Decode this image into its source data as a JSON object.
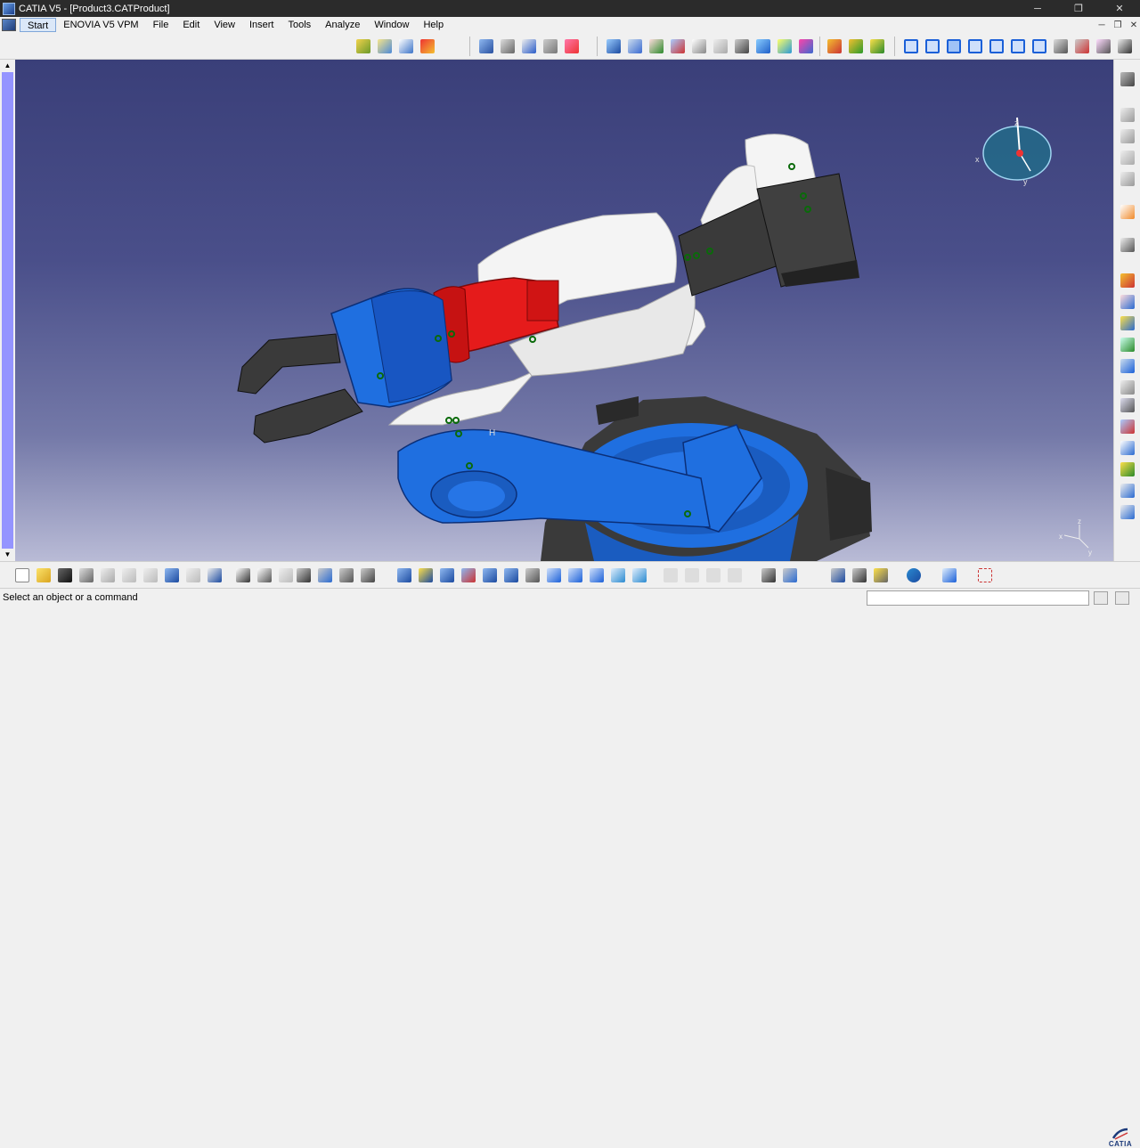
{
  "window": {
    "title": "CATIA V5 - [Product3.CATProduct]",
    "minimize": "─",
    "restore": "❐",
    "close": "✕"
  },
  "menubar": {
    "items": [
      "Start",
      "ENOVIA V5 VPM",
      "File",
      "Edit",
      "View",
      "Insert",
      "Tools",
      "Analyze",
      "Window",
      "Help"
    ],
    "mdi": {
      "minimize": "─",
      "restore": "❐",
      "close": "✕"
    }
  },
  "compass": {
    "x_label": "x",
    "y_label": "y",
    "z_label": "z"
  },
  "axis_triad": {
    "x_label": "x",
    "y_label": "y",
    "z_label": "z"
  },
  "plane_label": "H",
  "status": {
    "message": "Select an object or a command",
    "command_value": ""
  },
  "logo": {
    "text": "CATIA"
  },
  "colors": {
    "accent": "#1b60d8",
    "robot_blue": "#1f6fe0",
    "robot_red": "#e51b1b",
    "robot_white": "#f2f2f2",
    "robot_dark": "#3a3a3a"
  }
}
